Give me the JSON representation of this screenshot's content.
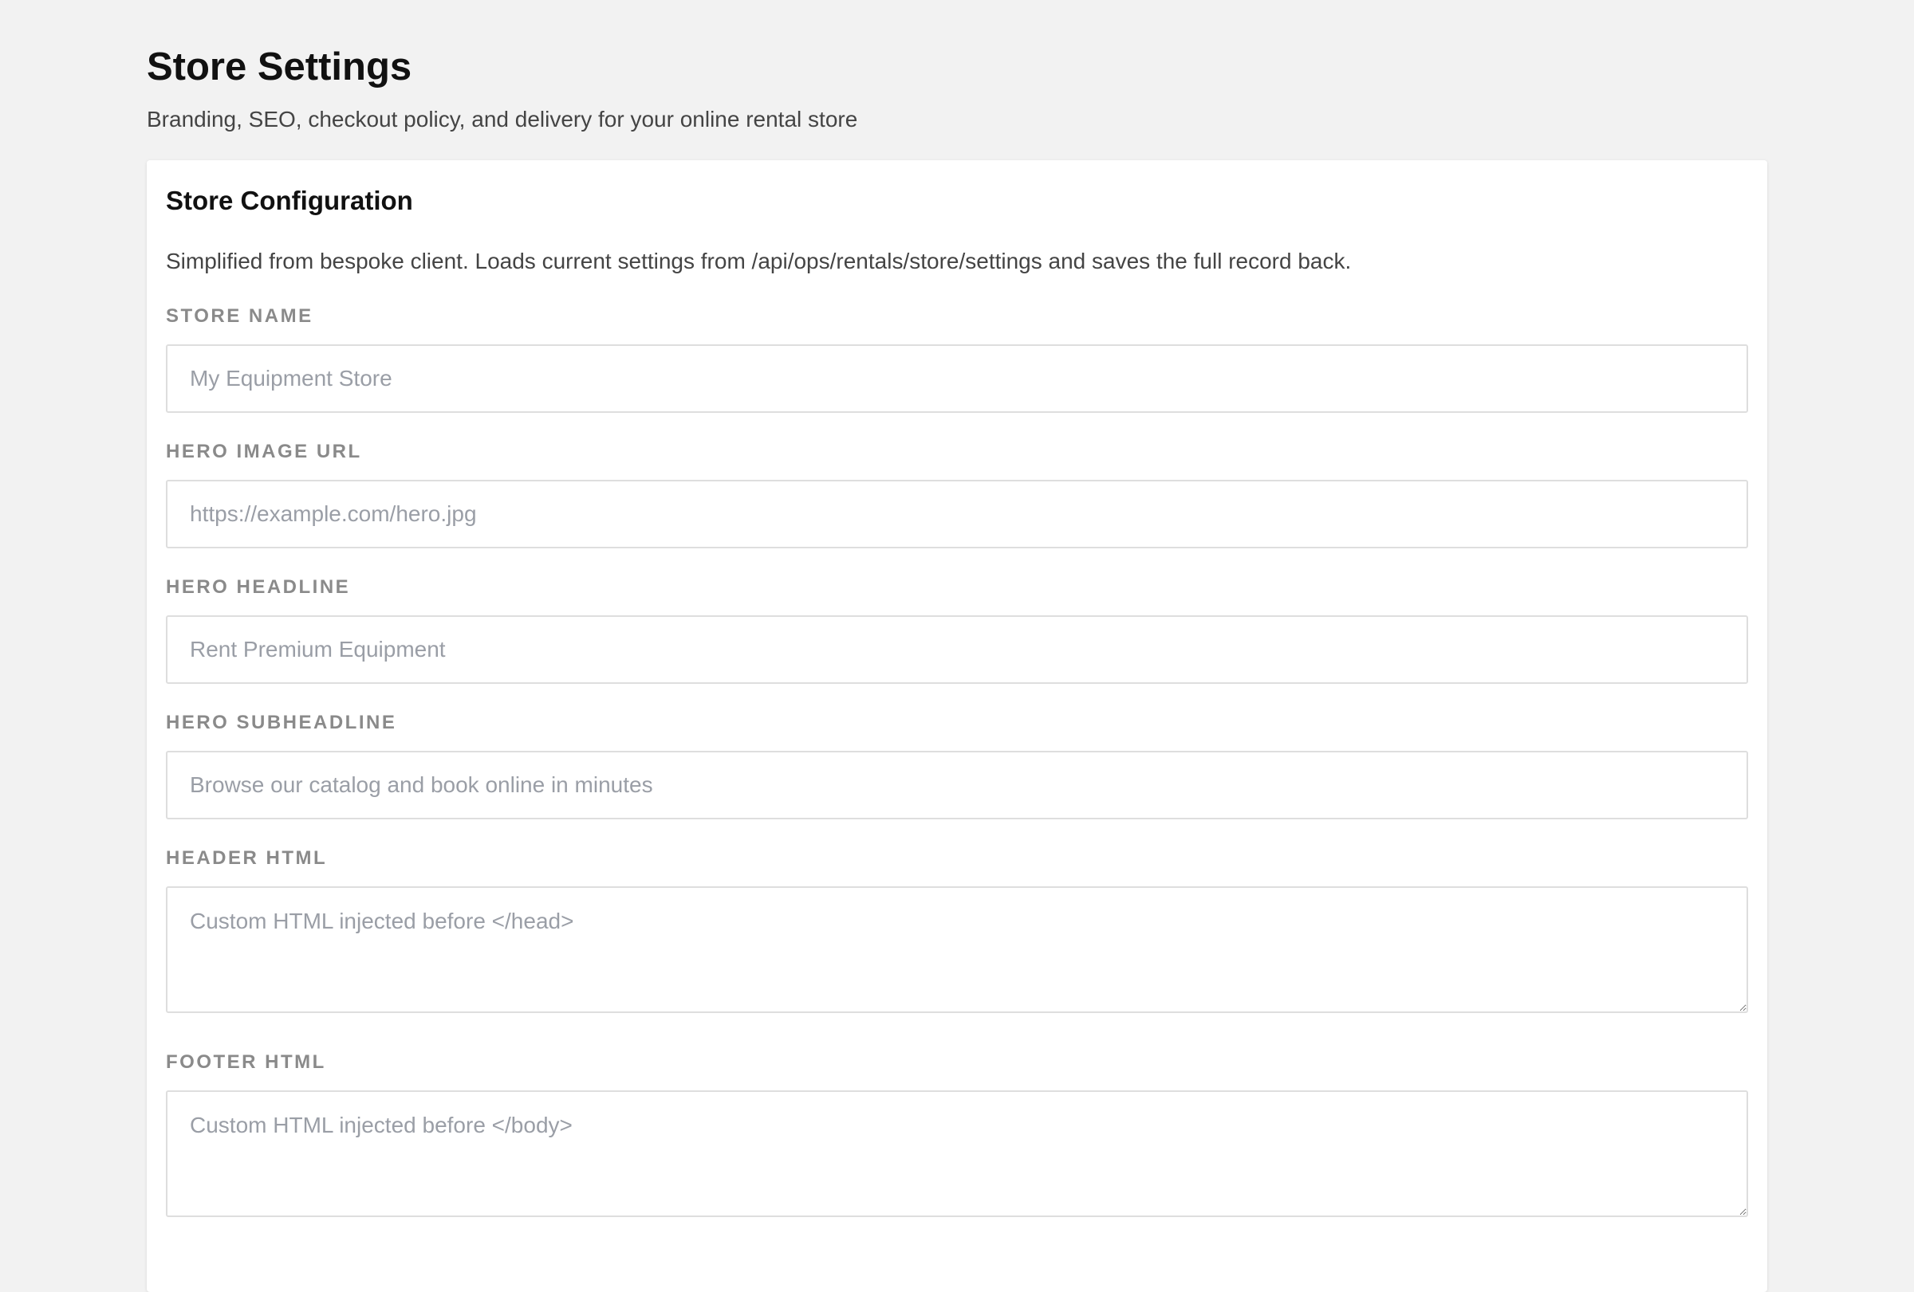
{
  "header": {
    "title": "Store Settings",
    "subtitle": "Branding, SEO, checkout policy, and delivery for your online rental store"
  },
  "card": {
    "title": "Store Configuration",
    "description": "Simplified from bespoke client. Loads current settings from /api/ops/rentals/store/settings and saves the full record back."
  },
  "fields": {
    "store_name": {
      "label": "STORE NAME",
      "value": "",
      "placeholder": "My Equipment Store"
    },
    "hero_image_url": {
      "label": "HERO IMAGE URL",
      "value": "",
      "placeholder": "https://example.com/hero.jpg"
    },
    "hero_headline": {
      "label": "HERO HEADLINE",
      "value": "",
      "placeholder": "Rent Premium Equipment"
    },
    "hero_subheadline": {
      "label": "HERO SUBHEADLINE",
      "value": "",
      "placeholder": "Browse our catalog and book online in minutes"
    },
    "header_html": {
      "label": "HEADER HTML",
      "value": "",
      "placeholder": "Custom HTML injected before </head>"
    },
    "footer_html": {
      "label": "FOOTER HTML",
      "value": "",
      "placeholder": "Custom HTML injected before </body>"
    }
  }
}
